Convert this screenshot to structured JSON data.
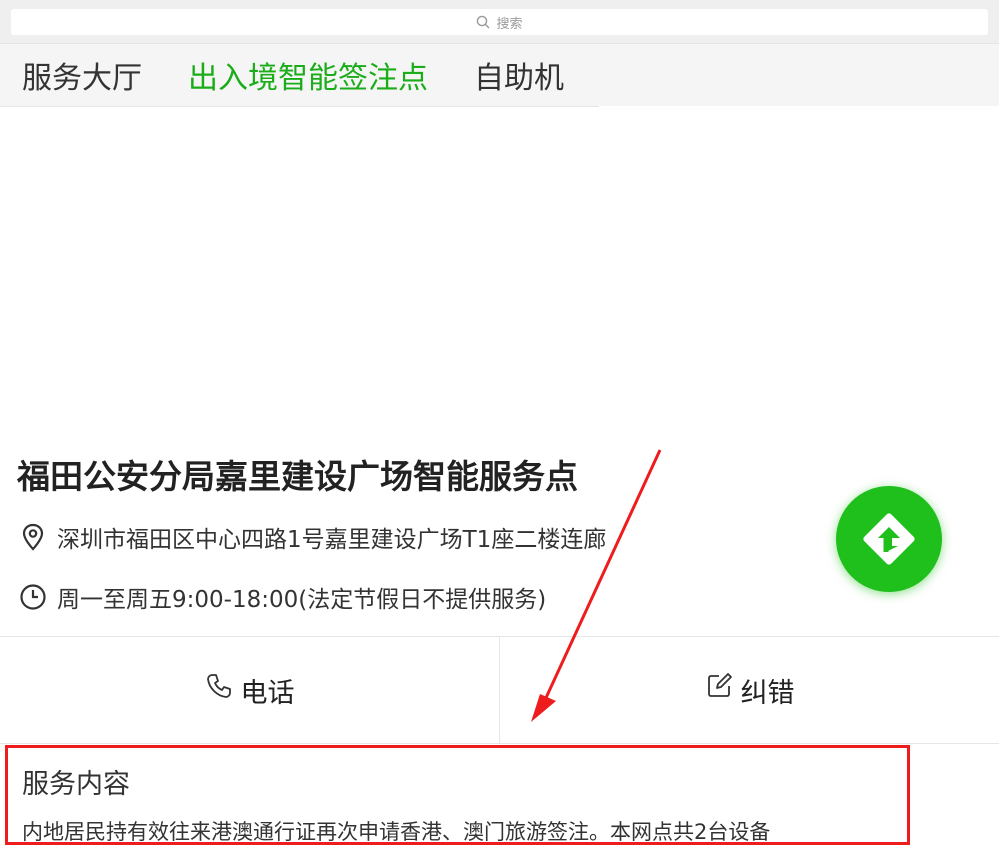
{
  "search": {
    "placeholder": "搜索",
    "icon": "search-icon"
  },
  "tabs": [
    {
      "label": "服务大厅",
      "active": false
    },
    {
      "label": "出入境智能签注点",
      "active": true
    },
    {
      "label": "自助机",
      "active": false
    }
  ],
  "colors": {
    "accent": "#1aad19",
    "fab": "#1fbf1c",
    "highlight_box": "#ee1c1c",
    "annotation_arrow": "#ee1c1c"
  },
  "location": {
    "name": "福田公安分局嘉里建设广场智能服务点",
    "address": "深圳市福田区中心四路1号嘉里建设广场T1座二楼连廊",
    "address_icon": "location-pin-icon",
    "hours": "周一至周五9:00-18:00(法定节假日不提供服务)",
    "hours_icon": "clock-icon"
  },
  "fab": {
    "icon": "navigation-turn-icon"
  },
  "actions": {
    "phone": {
      "label": "电话",
      "icon": "phone-icon"
    },
    "correct": {
      "label": "纠错",
      "icon": "edit-icon"
    }
  },
  "service": {
    "title": "服务内容",
    "content": "内地居民持有效往来港澳通行证再次申请香港、澳门旅游签注。本网点共2台设备"
  }
}
